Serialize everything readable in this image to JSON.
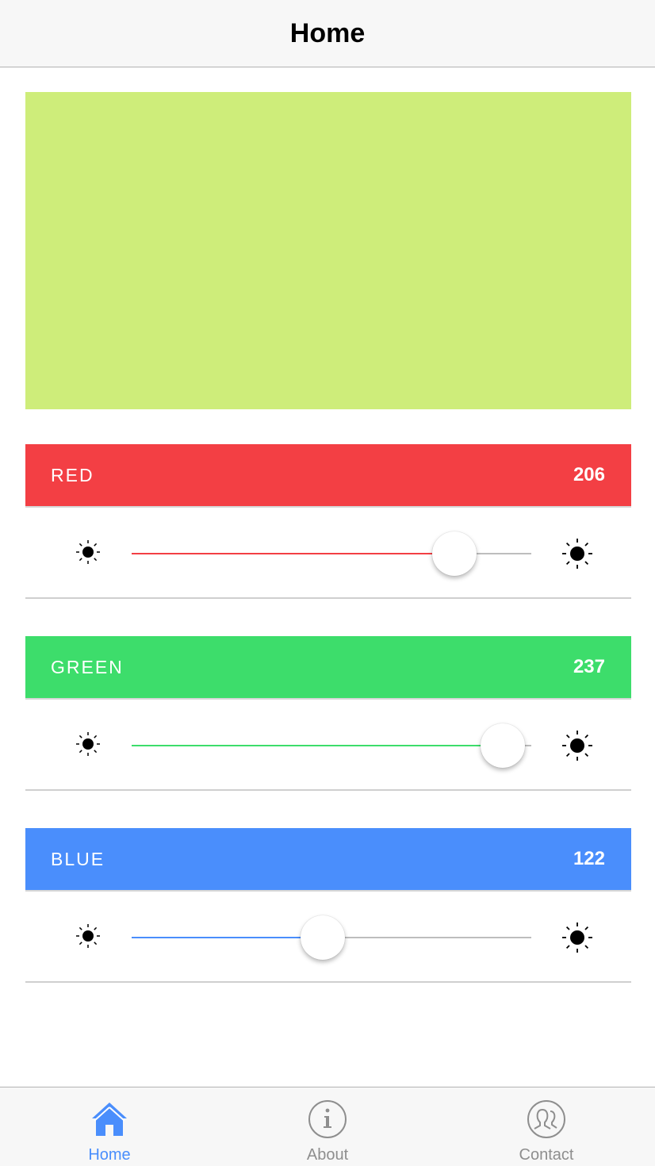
{
  "header": {
    "title": "Home"
  },
  "preview": {
    "color": "#CEED7A"
  },
  "channels": [
    {
      "label": "RED",
      "value": "206",
      "level": 206,
      "max": 255,
      "bar_color": "#F33F44",
      "fill_color": "#F33F44"
    },
    {
      "label": "GREEN",
      "value": "237",
      "level": 237,
      "max": 255,
      "bar_color": "#3DDD6B",
      "fill_color": "#3DDD6B"
    },
    {
      "label": "BLUE",
      "value": "122",
      "level": 122,
      "max": 255,
      "bar_color": "#4A8EFC",
      "fill_color": "#4A8EFC"
    }
  ],
  "icons": {
    "slider_min": "brightness-low-icon",
    "slider_max": "brightness-high-icon"
  },
  "tabbar": {
    "active_color": "#4A8EFC",
    "inactive_color": "#8E8E8E",
    "tabs": [
      {
        "label": "Home",
        "icon": "home-icon",
        "active": true
      },
      {
        "label": "About",
        "icon": "info-icon",
        "active": false
      },
      {
        "label": "Contact",
        "icon": "contact-icon",
        "active": false
      }
    ]
  }
}
